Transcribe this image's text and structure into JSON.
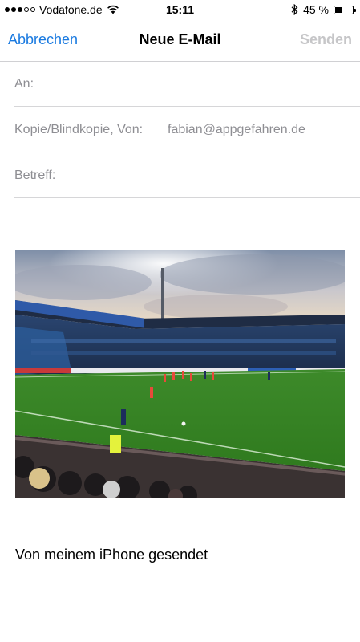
{
  "status_bar": {
    "carrier": "Vodafone.de",
    "time": "15:11",
    "battery_percent": "45 %",
    "battery_level": 0.45,
    "signal_bars_filled": 3,
    "signal_bars_total": 5
  },
  "nav": {
    "cancel_label": "Abbrechen",
    "title": "Neue E-Mail",
    "send_label": "Senden"
  },
  "fields": {
    "to_label": "An:",
    "cc_label": "Kopie/Blindkopie, Von:",
    "from_address": "fabian@appgefahren.de",
    "subject_label": "Betreff:"
  },
  "body": {
    "signature": "Von meinem iPhone gesendet"
  },
  "colors": {
    "accent": "#1a7ae0",
    "disabled": "#c6c6c8",
    "placeholder": "#8e8e93",
    "separator": "#d6d6d8"
  }
}
